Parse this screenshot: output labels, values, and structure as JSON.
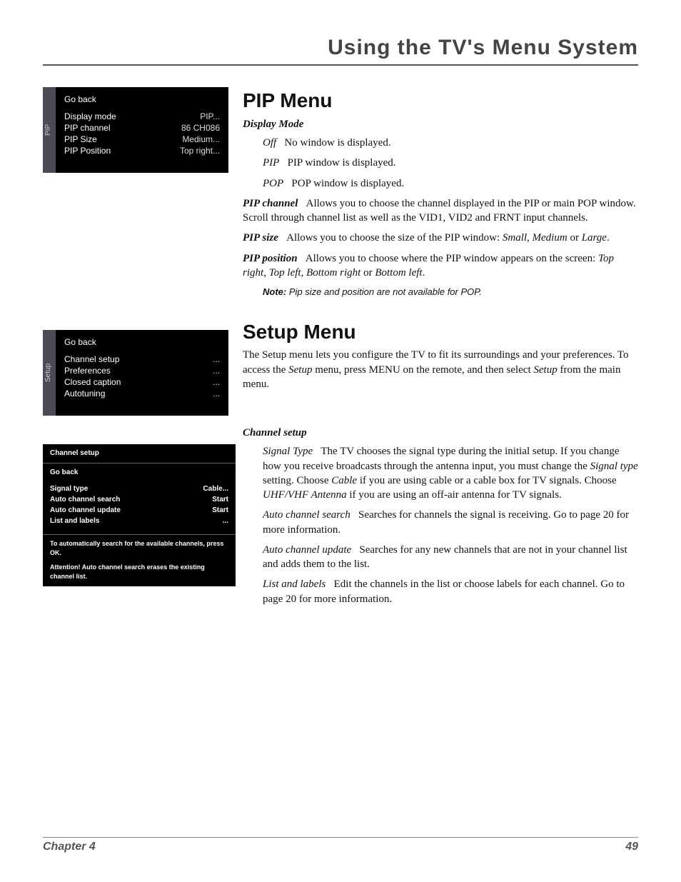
{
  "header": "Using the TV's Menu System",
  "pip_menu_ui": {
    "tab": "PIP",
    "go_back": "Go back",
    "rows": [
      {
        "label": "Display mode",
        "value": "PIP..."
      },
      {
        "label": "PIP channel",
        "value": "86   CH086"
      },
      {
        "label": "PIP Size",
        "value": "Medium..."
      },
      {
        "label": "PIP Position",
        "value": "Top right..."
      }
    ]
  },
  "setup_menu_ui": {
    "tab": "Setup",
    "go_back": "Go back",
    "rows": [
      {
        "label": "Channel setup",
        "value": "..."
      },
      {
        "label": "Preferences",
        "value": "..."
      },
      {
        "label": "Closed caption",
        "value": "..."
      },
      {
        "label": "Autotuning",
        "value": "..."
      }
    ]
  },
  "channel_setup_ui": {
    "title": "Channel setup",
    "go_back": "Go back",
    "rows": [
      {
        "label": "Signal type",
        "value": "Cable..."
      },
      {
        "label": "Auto channel search",
        "value": "Start"
      },
      {
        "label": "Auto channel update",
        "value": "Start"
      },
      {
        "label": "List and labels",
        "value": "..."
      }
    ],
    "hint": "To automatically search for the available channels, press OK.",
    "warn": "Attention! Auto channel search erases the existing channel list."
  },
  "text": {
    "pip_title": "PIP Menu",
    "display_mode_h": "Display Mode",
    "off_term": "Off",
    "off_desc": "No window is displayed.",
    "pip_term": "PIP",
    "pip_desc": "PIP window is displayed.",
    "pop_term": "POP",
    "pop_desc": "POP window is displayed.",
    "pip_channel_term": "PIP channel",
    "pip_channel_desc": "Allows you to choose the channel displayed in the PIP or main POP window. Scroll through channel list as well as the VID1, VID2 and FRNT input channels.",
    "pip_size_term": "PIP size",
    "pip_size_pre": "Allows you to choose the size of the PIP window: ",
    "small": "Small",
    "medium": "Medium",
    "or": " or ",
    "large": "Large",
    "pip_pos_term": "PIP position",
    "pip_pos_pre": "Allows you to choose where the PIP window appears on the screen: ",
    "tr": "Top right",
    "tl": "Top left",
    "br": "Bottom right",
    "bl": "Bottom left",
    "note_label": "Note:",
    "note_text": " Pip size and position are not available for POP.",
    "setup_title": "Setup Menu",
    "setup_intro_a": "The Setup menu lets you configure the TV to fit its surroundings and your preferences. To access the ",
    "setup_intro_term": "Setup",
    "setup_intro_b": " menu, press MENU on the remote, and then select ",
    "setup_intro_term2": "Setup",
    "setup_intro_c": " from the main menu.",
    "channel_setup_h": "Channel setup",
    "sig_term": "Signal Type",
    "sig_a": "The TV chooses the signal type during the initial setup. If you change how you receive broadcasts through the antenna input, you must change the ",
    "sig_type_it": "Signal type",
    "sig_b": " setting. Choose ",
    "cable": "Cable",
    "sig_c": " if you are using cable or a cable box for TV signals. Choose ",
    "uhf": "UHF/VHF Antenna",
    "sig_d": " if you are using an off-air antenna for TV signals.",
    "acs_term": "Auto channel search",
    "acs_desc": "Searches for channels the signal is receiving. Go to page 20 for more information.",
    "acu_term": "Auto channel update",
    "acu_desc": "Searches for any new channels that are not in your channel list and adds them to the list.",
    "ll_term": "List and labels",
    "ll_desc": "Edit the channels in the list or choose labels for each channel. Go to page 20 for more information."
  },
  "footer": {
    "left": "Chapter 4",
    "right": "49"
  }
}
